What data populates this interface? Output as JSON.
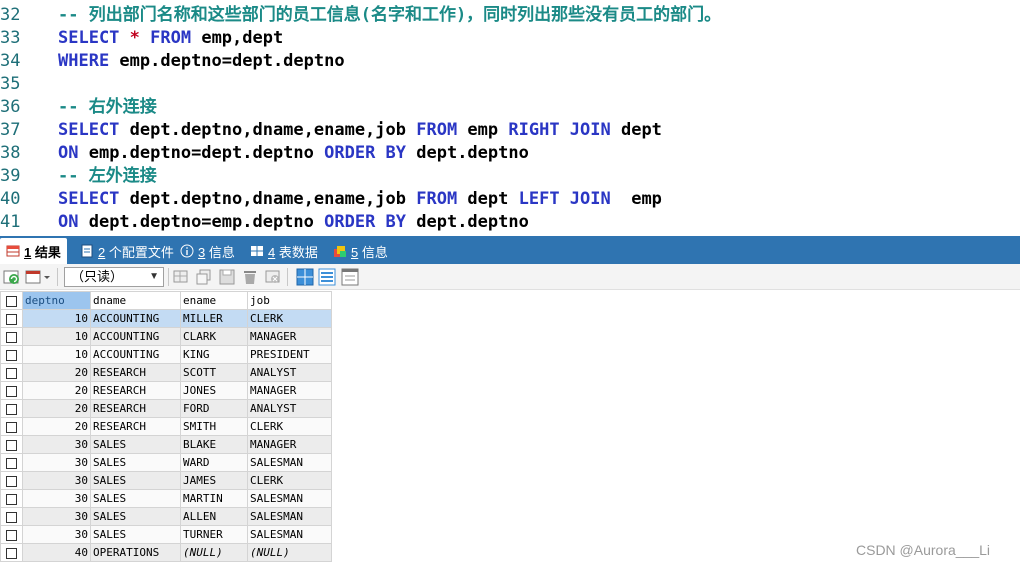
{
  "editor": {
    "lines": [
      {
        "no": "32",
        "tokens": [
          {
            "t": "-- 列出部门名称和这些部门的员工信息(名字和工作)，同时列出那些没有员工的部门。",
            "c": "cmt"
          }
        ]
      },
      {
        "no": "33",
        "tokens": [
          {
            "t": "SELECT ",
            "c": "kw"
          },
          {
            "t": "* ",
            "c": "star"
          },
          {
            "t": "FROM ",
            "c": "kw"
          },
          {
            "t": "emp,dept",
            "c": "plain"
          }
        ]
      },
      {
        "no": "34",
        "tokens": [
          {
            "t": "WHERE ",
            "c": "kw"
          },
          {
            "t": "emp.deptno=dept.deptno",
            "c": "plain"
          }
        ]
      },
      {
        "no": "35",
        "tokens": []
      },
      {
        "no": "36",
        "tokens": [
          {
            "t": "-- 右外连接",
            "c": "cmt"
          }
        ]
      },
      {
        "no": "37",
        "tokens": [
          {
            "t": "SELECT ",
            "c": "kw"
          },
          {
            "t": "dept.deptno,dname,ename,job ",
            "c": "plain"
          },
          {
            "t": "FROM ",
            "c": "kw"
          },
          {
            "t": "emp ",
            "c": "plain"
          },
          {
            "t": "RIGHT JOIN ",
            "c": "kw"
          },
          {
            "t": "dept",
            "c": "plain"
          }
        ]
      },
      {
        "no": "38",
        "tokens": [
          {
            "t": "ON ",
            "c": "kw"
          },
          {
            "t": "emp.deptno=dept.deptno ",
            "c": "plain"
          },
          {
            "t": "ORDER BY ",
            "c": "kw"
          },
          {
            "t": "dept.deptno",
            "c": "plain"
          }
        ]
      },
      {
        "no": "39",
        "tokens": [
          {
            "t": "-- 左外连接",
            "c": "cmt"
          }
        ]
      },
      {
        "no": "40",
        "tokens": [
          {
            "t": "SELECT ",
            "c": "kw"
          },
          {
            "t": "dept.deptno,dname,ename,job ",
            "c": "plain"
          },
          {
            "t": "FROM ",
            "c": "kw"
          },
          {
            "t": "dept ",
            "c": "plain"
          },
          {
            "t": "LEFT JOIN  ",
            "c": "kw"
          },
          {
            "t": "emp",
            "c": "plain"
          }
        ]
      },
      {
        "no": "41",
        "tokens": [
          {
            "t": "ON ",
            "c": "kw"
          },
          {
            "t": "dept.deptno=emp.deptno ",
            "c": "plain"
          },
          {
            "t": "ORDER BY ",
            "c": "kw"
          },
          {
            "t": "dept.deptno",
            "c": "plain"
          }
        ]
      }
    ]
  },
  "tabs": [
    {
      "num": "1",
      "label": " 结果",
      "icon": "table-icon",
      "active": true
    },
    {
      "num": "2",
      "label": " 个配置文件",
      "icon": "document-icon",
      "active": false
    },
    {
      "num": "3",
      "label": " 信息",
      "icon": "info-icon",
      "active": false
    },
    {
      "num": "4",
      "label": " 表数据",
      "icon": "grid-icon",
      "active": false
    },
    {
      "num": "5",
      "label": " 信息",
      "icon": "message-icon",
      "active": false
    }
  ],
  "toolbar": {
    "mode_value": "（只读）"
  },
  "grid": {
    "columns": [
      "deptno",
      "dname",
      "ename",
      "job"
    ],
    "rows": [
      [
        "10",
        "ACCOUNTING",
        "MILLER",
        "CLERK"
      ],
      [
        "10",
        "ACCOUNTING",
        "CLARK",
        "MANAGER"
      ],
      [
        "10",
        "ACCOUNTING",
        "KING",
        "PRESIDENT"
      ],
      [
        "20",
        "RESEARCH",
        "SCOTT",
        "ANALYST"
      ],
      [
        "20",
        "RESEARCH",
        "JONES",
        "MANAGER"
      ],
      [
        "20",
        "RESEARCH",
        "FORD",
        "ANALYST"
      ],
      [
        "20",
        "RESEARCH",
        "SMITH",
        "CLERK"
      ],
      [
        "30",
        "SALES",
        "BLAKE",
        "MANAGER"
      ],
      [
        "30",
        "SALES",
        "WARD",
        "SALESMAN"
      ],
      [
        "30",
        "SALES",
        "JAMES",
        "CLERK"
      ],
      [
        "30",
        "SALES",
        "MARTIN",
        "SALESMAN"
      ],
      [
        "30",
        "SALES",
        "ALLEN",
        "SALESMAN"
      ],
      [
        "30",
        "SALES",
        "TURNER",
        "SALESMAN"
      ],
      [
        "40",
        "OPERATIONS",
        "(NULL)",
        "(NULL)"
      ]
    ]
  },
  "watermark": "CSDN @Aurora___Li"
}
